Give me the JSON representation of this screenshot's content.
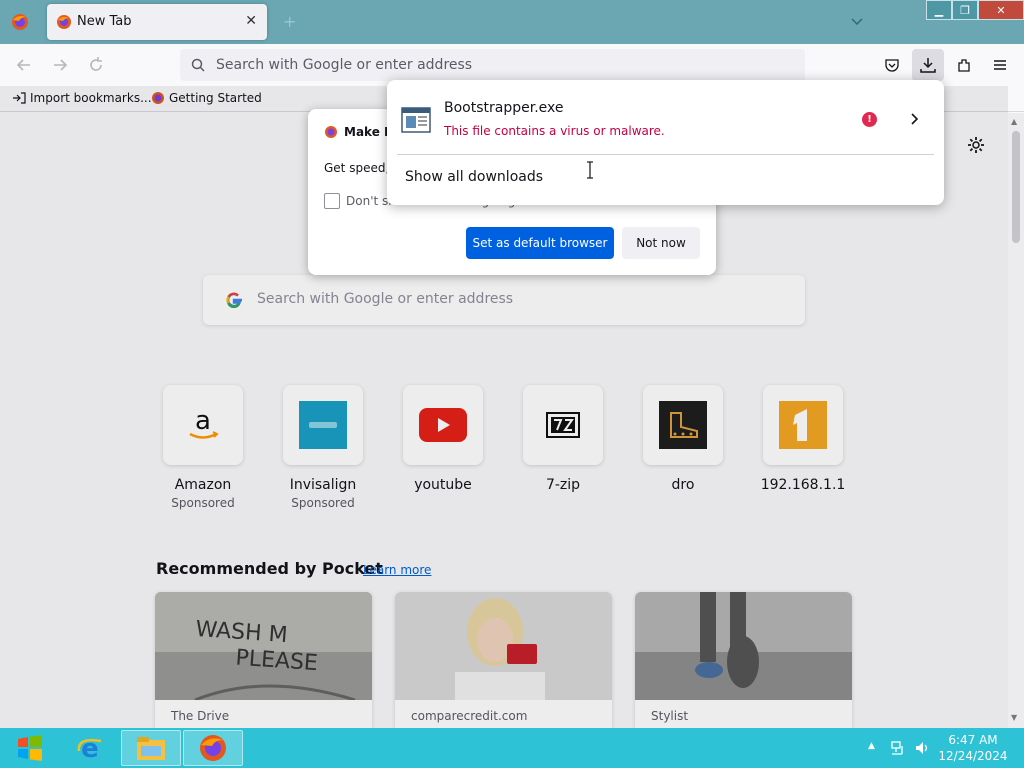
{
  "tabs": [
    {
      "title": "New Tab",
      "close_icon": "close-icon"
    }
  ],
  "window_controls": [
    "minimize",
    "restore",
    "close"
  ],
  "urlbar": {
    "placeholder": "Search with Google or enter address"
  },
  "bookmarks": [
    {
      "label": "Import bookmarks...",
      "icon": "import-icon"
    },
    {
      "label": "Getting Started",
      "icon": "firefox-icon"
    }
  ],
  "default_browser_dialog": {
    "title": "Make Fi",
    "body": "Get speed, s",
    "checkbox_label": "Don't show this message again",
    "primary_button": "Set as default browser",
    "secondary_button": "Not now"
  },
  "downloads_panel": {
    "file_name": "Bootstrapper.exe",
    "status": "This file contains a virus or malware.",
    "show_all": "Show all downloads",
    "warning_glyph": "!",
    "status_color": "#c50042"
  },
  "newtab": {
    "search_placeholder": "Search with Google or enter address",
    "top_sites": [
      {
        "name": "Amazon",
        "sponsored": "Sponsored",
        "icon": "amazon-icon"
      },
      {
        "name": "Invisalign",
        "sponsored": "Sponsored",
        "icon": "invisalign-icon"
      },
      {
        "name": "youtube",
        "sponsored": "",
        "icon": "youtube-icon"
      },
      {
        "name": "7-zip",
        "sponsored": "",
        "icon": "7zip-icon"
      },
      {
        "name": "dro",
        "sponsored": "",
        "icon": "dro-icon"
      },
      {
        "name": "192.168.1.1",
        "sponsored": "",
        "icon": "orange-one-icon"
      }
    ],
    "pocket": {
      "heading": "Recommended by Pocket",
      "learn_more": "Learn more",
      "cards": [
        {
          "source": "The Drive"
        },
        {
          "source": "comparecredit.com"
        },
        {
          "source": "Stylist"
        }
      ]
    }
  },
  "taskbar": {
    "time": "6:47 AM",
    "date": "12/24/2024",
    "apps": [
      "internet-explorer",
      "file-explorer",
      "firefox"
    ]
  },
  "colors": {
    "tabbar": "#6aa7b3",
    "accent_blue": "#0061e0",
    "taskbar": "#2dc2d6",
    "warning_red": "#e22850"
  }
}
